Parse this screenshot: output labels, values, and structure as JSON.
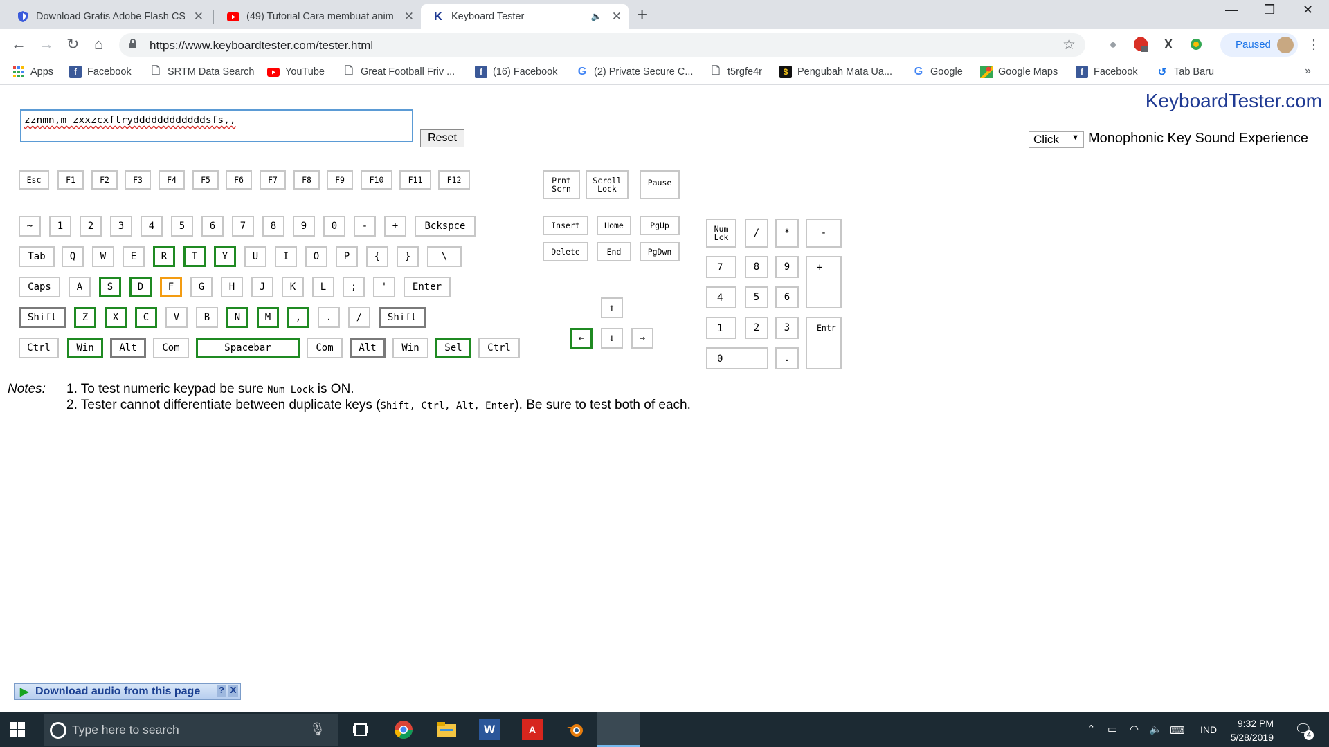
{
  "browser": {
    "tabs": [
      {
        "title": "Download Gratis Adobe Flash CS",
        "icon": "shield-icon"
      },
      {
        "title": "(49) Tutorial Cara membuat anim",
        "icon": "youtube-icon"
      },
      {
        "title": "Keyboard Tester",
        "icon": "k-icon"
      }
    ],
    "url": "https://www.keyboardtester.com/tester.html",
    "profile_status": "Paused",
    "bookmarks": [
      {
        "label": "Apps",
        "icon": "apps-grid-icon"
      },
      {
        "label": "Facebook",
        "icon": "facebook-icon"
      },
      {
        "label": "SRTM Data Search",
        "icon": "page-icon"
      },
      {
        "label": "YouTube",
        "icon": "youtube-icon"
      },
      {
        "label": "Great Football Friv ...",
        "icon": "page-icon"
      },
      {
        "label": "(16) Facebook",
        "icon": "facebook-icon"
      },
      {
        "label": "(2) Private Secure C...",
        "icon": "google-icon"
      },
      {
        "label": "t5rgfe4r",
        "icon": "page-icon"
      },
      {
        "label": "Pengubah Mata Ua...",
        "icon": "dollar-icon"
      },
      {
        "label": "Google",
        "icon": "google-icon"
      },
      {
        "label": "Google Maps",
        "icon": "maps-icon"
      },
      {
        "label": "Facebook",
        "icon": "facebook-icon"
      },
      {
        "label": "Tab Baru",
        "icon": "history-icon"
      }
    ]
  },
  "page": {
    "brand": "KeyboardTester.com",
    "typed_text": "zznmn,m zxxzcxftryddddddddddddsfs,,",
    "reset_label": "Reset",
    "sound_option": "Click",
    "sound_label": "Monophonic Key Sound Experience",
    "notes": {
      "label": "Notes:",
      "line1_a": "1. To test numeric keypad be sure ",
      "line1_code": "Num Lock",
      "line1_b": " is ON.",
      "line2_a": "2. Tester cannot differentiate between duplicate keys (",
      "line2_code": "Shift, Ctrl, Alt, Enter",
      "line2_b": "). Be sure to test both of each."
    },
    "download_bar": {
      "label": "Download audio from this page",
      "help": "?",
      "close": "X"
    }
  },
  "keys": {
    "fn": [
      "Esc",
      "F1",
      "F2",
      "F3",
      "F4",
      "F5",
      "F6",
      "F7",
      "F8",
      "F9",
      "F10",
      "F11",
      "F12"
    ],
    "row1": [
      "~",
      "1",
      "2",
      "3",
      "4",
      "5",
      "6",
      "7",
      "8",
      "9",
      "0",
      "-",
      "+",
      "Bckspce"
    ],
    "row2": [
      "Tab",
      "Q",
      "W",
      "E",
      "R",
      "T",
      "Y",
      "U",
      "I",
      "O",
      "P",
      "{",
      "}",
      "\\"
    ],
    "row3": [
      "Caps",
      "A",
      "S",
      "D",
      "F",
      "G",
      "H",
      "J",
      "K",
      "L",
      ";",
      "'",
      "Enter"
    ],
    "row4": [
      "Shift",
      "Z",
      "X",
      "C",
      "V",
      "B",
      "N",
      "M",
      ",",
      ".",
      "/",
      "Shift"
    ],
    "row5": [
      "Ctrl",
      "Win",
      "Alt",
      "Com",
      "Spacebar",
      "Com",
      "Alt",
      "Win",
      "Sel",
      "Ctrl"
    ],
    "sys": [
      "Prnt Scrn",
      "Scroll Lock",
      "Pause"
    ],
    "nav": [
      "Insert",
      "Home",
      "PgUp",
      "Delete",
      "End",
      "PgDwn"
    ],
    "arrows": [
      "↑",
      "←",
      "↓",
      "→"
    ],
    "numpad": [
      "Num Lck",
      "/",
      "*",
      "-",
      "7",
      "8",
      "9",
      "+",
      "4",
      "5",
      "6",
      "1",
      "2",
      "3",
      "Entr",
      "0",
      "."
    ],
    "state_colors": {
      "tested": "#1f8a22",
      "active": "#f39c12",
      "untested": "#c7c7c7"
    }
  },
  "taskbar": {
    "search_placeholder": "Type here to search",
    "language": "IND",
    "time": "9:32 PM",
    "date": "5/28/2019",
    "notifications": "4"
  }
}
